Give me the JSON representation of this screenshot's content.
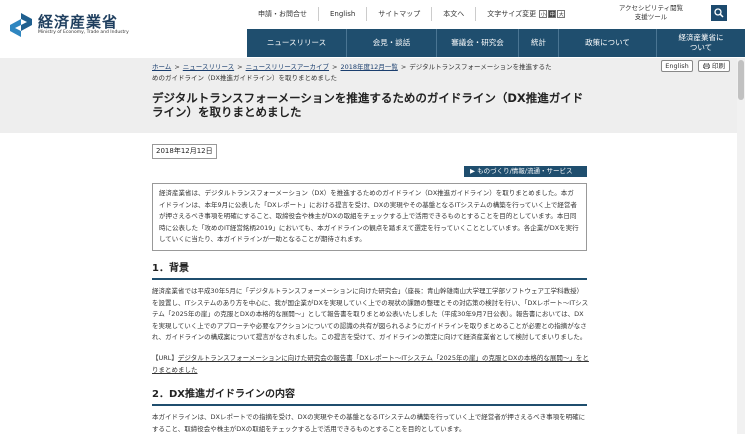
{
  "header": {
    "logo_jp": "経済産業省",
    "logo_en": "Ministry of Economy, Trade and Industry",
    "util_links": [
      "申請・お問合せ",
      "English",
      "サイトマップ",
      "本文へ"
    ],
    "font_size_label": "文字サイズ変更",
    "font_size_options": [
      "小",
      "中",
      "大"
    ],
    "accessibility_label": "アクセシビリティ閲覧支援ツール",
    "search_icon": "search-icon"
  },
  "nav": [
    "ニュースリリース",
    "会見・談話",
    "審議会・研究会",
    "統計",
    "政策について",
    "経済産業省について"
  ],
  "breadcrumb": {
    "items": [
      "ホーム",
      "ニュースリリース",
      "ニュースリリースアーカイブ",
      "2018年度12月一覧"
    ],
    "current": "デジタルトランスフォーメーションを推進するためのガイドライン（DX推進ガイドライン）を取りまとめました"
  },
  "actions": {
    "english": "English",
    "print": "印刷",
    "print_icon": "printer-icon"
  },
  "page_title": "デジタルトランスフォーメーションを推進するためのガイドライン（DX推進ガイドライン）を取りまとめました",
  "date": "2018年12月12日",
  "category": "▶ ものづくり/情報/流通・サービス",
  "summary": "経済産業省は、デジタルトランスフォーメーション（DX）を推進するためのガイドライン（DX推進ガイドライン）を取りまとめました。本ガイドラインは、本年9月に公表した「DXレポート」における提言を受け、DXの実現やその基盤となるITシステムの構築を行っていく上で経営者が押さえるべき事項を明確にすること、取締役会や株主がDXの取組をチェックする上で活用できるものとすることを目的としています。本日同時に公表した「攻めのIT経営銘柄2019」においても、本ガイドラインの観点を踏まえて選定を行っていくこととしています。各企業がDXを実行していくに当たり、本ガイドラインが一助となることが期待されます。",
  "section1": {
    "heading": "1．背景",
    "body": "経済産業省では平成30年5月に「デジタルトランスフォーメーションに向けた研究会」（座長：青山幹雄南山大学理工学部ソフトウェア工学科教授）を設置し、ITシステムのあり方を中心に、我が国企業がDXを実現していく上での現状の課題の整理とその対応策の検討を行い、「DXレポート～ITシステム「2025年の崖」の克服とDXの本格的な展開～」として報告書を取りまとめ公表いたしました（平成30年9月7日公表）。報告書においては、DXを実現していく上でのアプローチや必要なアクションについての認識の共有が図られるようにガイドラインを取りまとめることが必要との指摘がなされ、ガイドラインの構成案について提言がなされました。この提言を受けて、ガイドラインの策定に向けて経済産業省として検討してまいりました。",
    "url_label": "【URL】",
    "url_text": "デジタルトランスフォーメーションに向けた研究会の報告書「DXレポート～ITシステム「2025年の崖」の克服とDXの本格的な展開～」をとりまとめました"
  },
  "section2": {
    "heading": "2．DX推進ガイドラインの内容",
    "body": "本ガイドラインは、DXレポートでの指摘を受け、DXの実現やその基盤となるITシステムの構築を行っていく上で経営者が押さえるべき事項を明確にすること、取締役会や株主がDXの取組をチェックする上で活用できるものとすることを目的としています。"
  }
}
